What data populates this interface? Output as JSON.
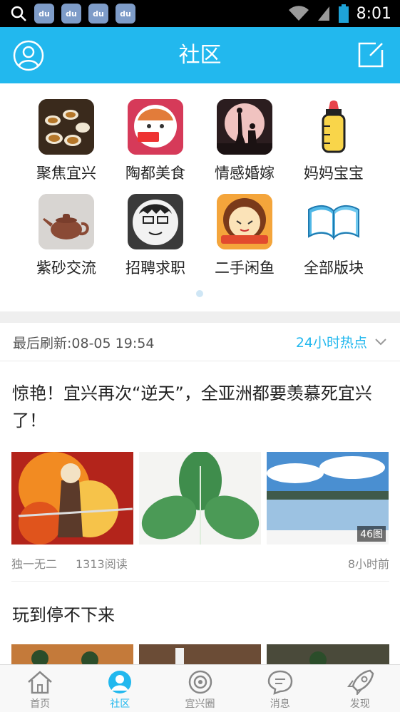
{
  "status_bar": {
    "time": "8:01",
    "badges": [
      "du",
      "du",
      "du",
      "du"
    ]
  },
  "header": {
    "title": "社区"
  },
  "forums": [
    {
      "label": "聚焦宜兴",
      "icon": "tea-cups-icon",
      "bg": "#3a2a1c"
    },
    {
      "label": "陶都美食",
      "icon": "foodie-cartoon-icon",
      "bg": "#d63a59"
    },
    {
      "label": "情感婚嫁",
      "icon": "proposal-silhouette-icon",
      "bg": "#2b1d1f"
    },
    {
      "label": "妈妈宝宝",
      "icon": "baby-bottle-icon",
      "bg": "#ffffff"
    },
    {
      "label": "紫砂交流",
      "icon": "teapot-icon",
      "bg": "#d8d5d2"
    },
    {
      "label": "招聘求职",
      "icon": "job-cartoon-icon",
      "bg": "#e9e9e9"
    },
    {
      "label": "二手闲鱼",
      "icon": "secondhand-market-icon",
      "bg": "#f4a53b"
    },
    {
      "label": "全部版块",
      "icon": "open-book-icon",
      "bg": "#ffffff"
    }
  ],
  "refresh": {
    "text": "最后刷新:08-05 19:54",
    "hot_label": "24小时热点"
  },
  "post1": {
    "title": "惊艳！宜兴再次“逆天”，全亚洲都要羡慕死宜兴了！",
    "image_count": "46图",
    "author": "独一无二",
    "reads": "1313阅读",
    "time": "8小时前"
  },
  "post2": {
    "title": "玩到停不下来"
  },
  "nav": [
    {
      "label": "首页",
      "icon": "home-icon",
      "active": false
    },
    {
      "label": "社区",
      "icon": "community-icon",
      "active": true
    },
    {
      "label": "宜兴圈",
      "icon": "circle-icon",
      "active": false
    },
    {
      "label": "消息",
      "icon": "message-icon",
      "active": false
    },
    {
      "label": "发现",
      "icon": "rocket-icon",
      "active": false
    }
  ],
  "colors": {
    "accent": "#22b8ee",
    "status_bar": "#000000"
  }
}
